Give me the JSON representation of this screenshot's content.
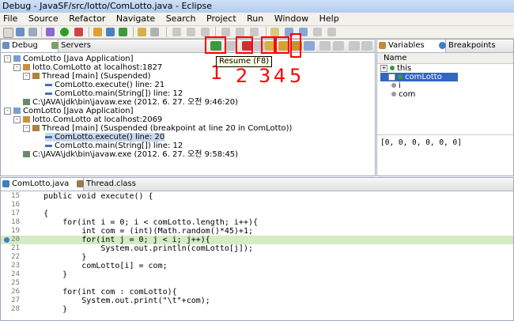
{
  "window": {
    "title": "Debug - JavaSF/src/lotto/ComLotto.java - Eclipse"
  },
  "menu": [
    "File",
    "Source",
    "Refactor",
    "Navigate",
    "Search",
    "Project",
    "Run",
    "Window",
    "Help"
  ],
  "debug_view": {
    "tabs": [
      {
        "label": "Debug"
      },
      {
        "label": "Servers"
      }
    ],
    "tooltip": "Resume (F8)",
    "annotations": [
      "1",
      "2",
      "3",
      "4",
      "5"
    ],
    "tree": [
      "ComLotto [Java Application]",
      "lotto.ComLotto at localhost:1827",
      "Thread [main] (Suspended)",
      "ComLotto.execute() line: 21",
      "ComLotto.main(String[]) line: 12",
      "C:\\JAVA\\jdk\\bin\\javaw.exe (2012. 6. 27. 오전 9:46:20)",
      "ComLotto [Java Application]",
      "lotto.ComLotto at localhost:2069",
      "Thread [main] (Suspended (breakpoint at line 20 in ComLotto))",
      "ComLotto.execute() line: 20",
      "ComLotto.main(String[]) line: 12",
      "C:\\JAVA\\jdk\\bin\\javaw.exe (2012. 6. 27. 오전 9:58:45)"
    ]
  },
  "variables_view": {
    "tabs": [
      {
        "label": "Variables"
      },
      {
        "label": "Breakpoints"
      }
    ],
    "column": "Name",
    "rows": [
      "this",
      "comLotto",
      "i",
      "com"
    ],
    "value": "[0, 0, 0, 0, 0, 0]"
  },
  "editor": {
    "tabs": [
      {
        "label": "ComLotto.java"
      },
      {
        "label": "Thread.class"
      }
    ],
    "lines": [
      {
        "n": "15",
        "text": "    public void execute() {"
      },
      {
        "n": "16",
        "text": ""
      },
      {
        "n": "17",
        "text": "    {"
      },
      {
        "n": "18",
        "text": "        for(int i = 0; i < comLotto.length; i++){"
      },
      {
        "n": "19",
        "text": "            int com = (int)(Math.random()*45)+1;"
      },
      {
        "n": "20",
        "text": "            for(int j = 0; j < i; j++){"
      },
      {
        "n": "21",
        "text": "                System.out.println(comLotto[j]);"
      },
      {
        "n": "22",
        "text": "            }"
      },
      {
        "n": "23",
        "text": "            comLotto[i] = com;"
      },
      {
        "n": "24",
        "text": "        }"
      },
      {
        "n": "25",
        "text": ""
      },
      {
        "n": "26",
        "text": "        for(int com : comLotto){"
      },
      {
        "n": "27",
        "text": "            System.out.print(\"\\t\"+com);"
      },
      {
        "n": "28",
        "text": "        }"
      }
    ]
  }
}
